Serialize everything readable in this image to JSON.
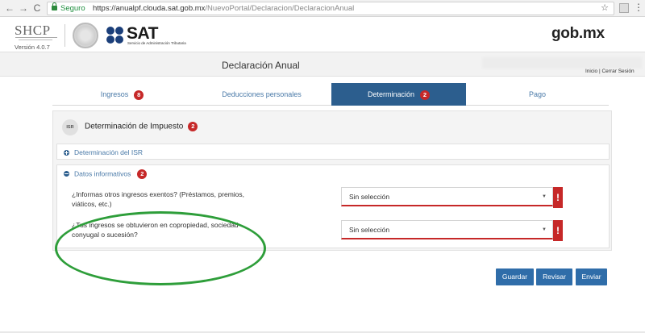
{
  "browser": {
    "back": "←",
    "forward": "→",
    "reload": "C",
    "secure_label": "Seguro",
    "url_host": "https://anualpf.clouda.sat.gob.mx",
    "url_path": "/NuevoPortal/Declaracion/DeclaracionAnual",
    "star": "☆",
    "menu": "⋮"
  },
  "header": {
    "shcp": "SHCP",
    "version": "Versión 4.0.7",
    "sat_logo_text": "SAT",
    "sat_subtitle": "Servicio de Administración Tributaria",
    "gobmx": "gob.mx"
  },
  "title_bar": {
    "title": "Declaración Anual",
    "user_links": "Inicio | Cerrar Sesión"
  },
  "tabs": [
    {
      "label": "Ingresos",
      "badge": "8",
      "active": false
    },
    {
      "label": "Deducciones personales",
      "badge": "",
      "active": false
    },
    {
      "label": "Determinación",
      "badge": "2",
      "active": true
    },
    {
      "label": "Pago",
      "badge": "",
      "active": false
    }
  ],
  "panel": {
    "icon_text": "ISR",
    "title": "Determinación de Impuesto",
    "title_badge": "2",
    "section_isr": "Determinación del ISR",
    "section_datos": "Datos informativos",
    "section_datos_badge": "2",
    "questions": [
      {
        "text": "¿Informas otros ingresos exentos? (Préstamos, premios, viáticos, etc.)",
        "value": "Sin selección"
      },
      {
        "text": "¿Tus ingresos se obtuvieron en copropiedad, sociedad conyugal o sucesión?",
        "value": "Sin selección"
      }
    ],
    "error_mark": "!",
    "caret": "▼"
  },
  "buttons": {
    "save": "Guardar",
    "review": "Revisar",
    "send": "Enviar"
  },
  "colors": {
    "primary": "#2c5e8e",
    "button": "#2f6da9",
    "error": "#c62828",
    "highlight": "#2e9e3a"
  }
}
